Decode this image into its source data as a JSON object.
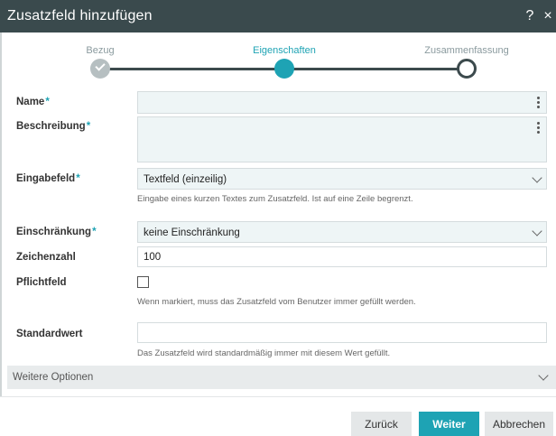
{
  "window": {
    "title": "Zusatzfeld hinzufügen",
    "help_label": "?",
    "close_label": "×"
  },
  "steps": [
    {
      "label": "Bezug",
      "state": "done"
    },
    {
      "label": "Eigenschaften",
      "state": "active"
    },
    {
      "label": "Zusammenfassung",
      "state": "todo"
    }
  ],
  "form": {
    "name": {
      "label": "Name",
      "value": ""
    },
    "beschreibung": {
      "label": "Beschreibung",
      "value": ""
    },
    "eingabefeld": {
      "label": "Eingabefeld",
      "value": "Textfeld (einzeilig)",
      "hint": "Eingabe eines kurzen Textes zum Zusatzfeld. Ist auf eine Zeile begrenzt."
    },
    "einschraenkung": {
      "label": "Einschränkung",
      "value": "keine Einschränkung"
    },
    "zeichenzahl": {
      "label": "Zeichenzahl",
      "value": "100"
    },
    "pflichtfeld": {
      "label": "Pflichtfeld",
      "checked": false,
      "hint": "Wenn markiert, muss das Zusatzfeld vom Benutzer immer gefüllt werden."
    },
    "standardwert": {
      "label": "Standardwert",
      "value": "",
      "hint": "Das Zusatzfeld wird standardmäßig immer mit diesem Wert gefüllt."
    },
    "required_mark": "*"
  },
  "more_options": {
    "label": "Weitere Optionen"
  },
  "buttons": {
    "back": "Zurück",
    "next": "Weiter",
    "cancel": "Abbrechen"
  },
  "colors": {
    "titlebar": "#3a4a4d",
    "accent": "#1ea3b4",
    "field_bg": "#eef5f6"
  }
}
